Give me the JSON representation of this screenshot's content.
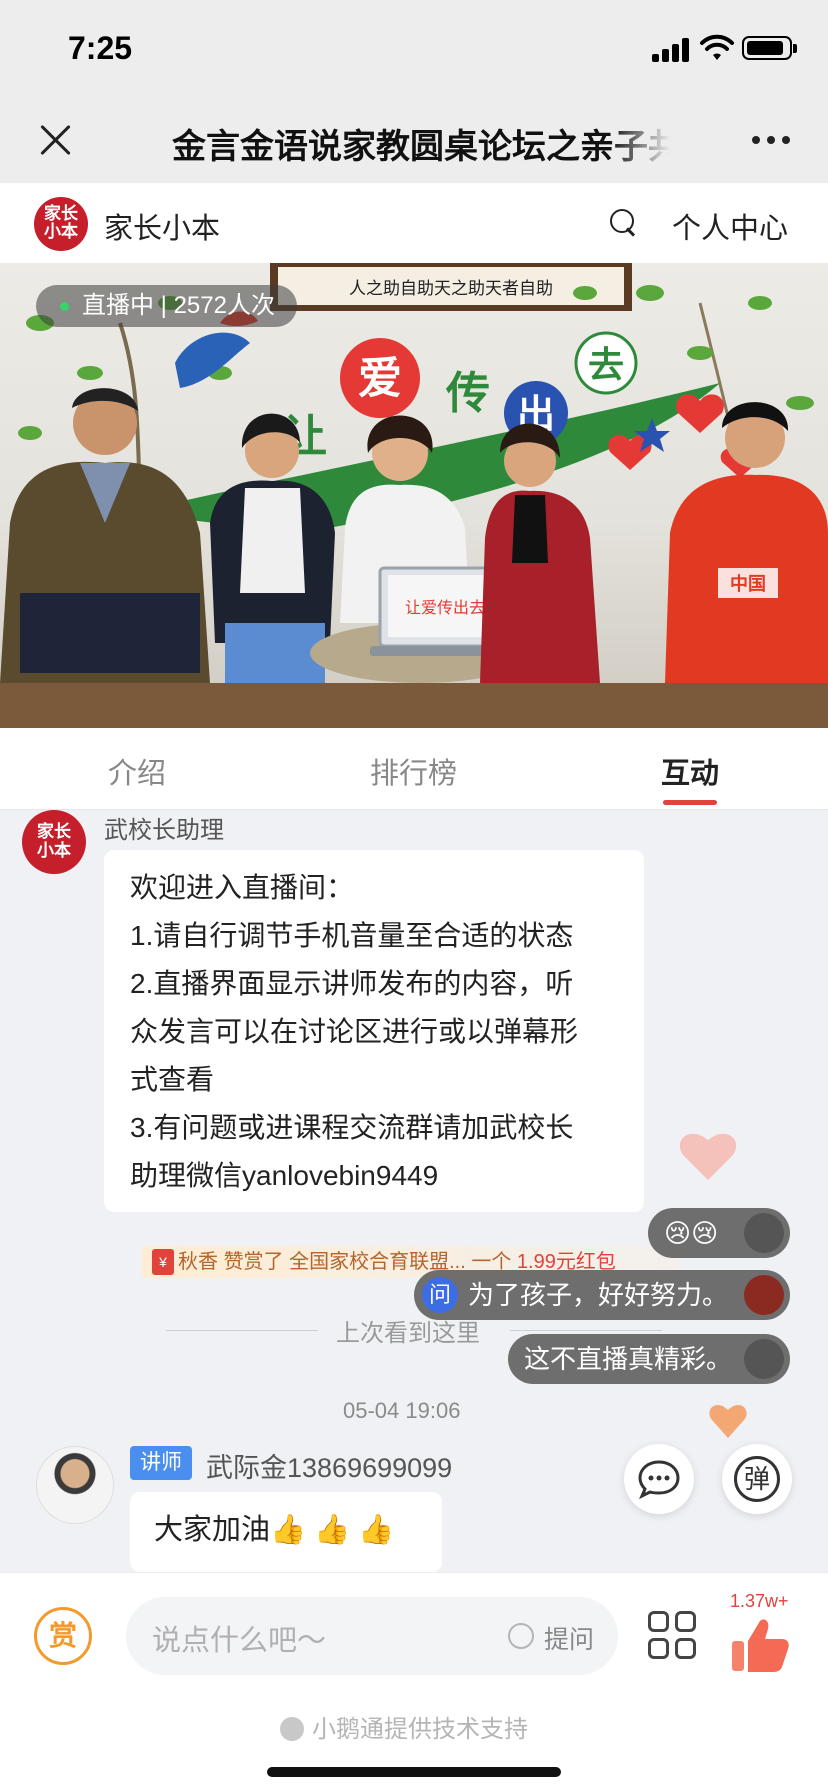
{
  "status_bar": {
    "time": "7:25"
  },
  "title_bar": {
    "title": "金言金语说家教圆桌论坛之亲子共成长"
  },
  "brand_bar": {
    "logo_text": "家长小本",
    "name": "家长小本",
    "personal_center": "个人中心"
  },
  "video": {
    "live_status": "直播中 | 2572人次",
    "banner_text": "让爱传出去",
    "calligraphy": "人之助自助天之助天者自助"
  },
  "tabs": {
    "intro": "介绍",
    "ranking": "排行榜",
    "interact": "互动"
  },
  "messages": {
    "assistant": {
      "sender": "武校长助理",
      "lines": [
        "欢迎进入直播间：",
        "1.请自行调节手机音量至合适的状态",
        "2.直播界面显示讲师发布的内容，听",
        "众发言可以在讨论区进行或以弹幕形",
        "式查看",
        "3.有问题或进课程交流群请加武校长",
        "助理微信yanlovebin9449"
      ]
    },
    "gift": {
      "user": "秋香",
      "action": "赞赏了",
      "target": "全国家校合育联盟...",
      "amount_prefix": "一个",
      "amount": "1.99元红包"
    },
    "last_seen": "上次看到这里",
    "timestamp": "05-04 19:06",
    "lecturer": {
      "badge": "讲师",
      "sender": "武际金13869699099",
      "text": "大家加油👍 👍 👍"
    }
  },
  "danmaku": {
    "emoji": "😢😢",
    "question_tag": "问",
    "question": "为了孩子，好好努力。",
    "comment": "这不直播真精彩。"
  },
  "floating": {
    "danmu_toggle": "弹"
  },
  "bottom_bar": {
    "reward_label": "赏",
    "input_placeholder": "说点什么吧～",
    "ask_label": "提问",
    "like_count": "1.37w+",
    "support_text": "小鹅通提供技术支持"
  },
  "colors": {
    "accent_red": "#e0433b",
    "reward_orange": "#f39a2b",
    "teacher_blue": "#4a8ff0",
    "brand_red": "#c41f2b"
  }
}
